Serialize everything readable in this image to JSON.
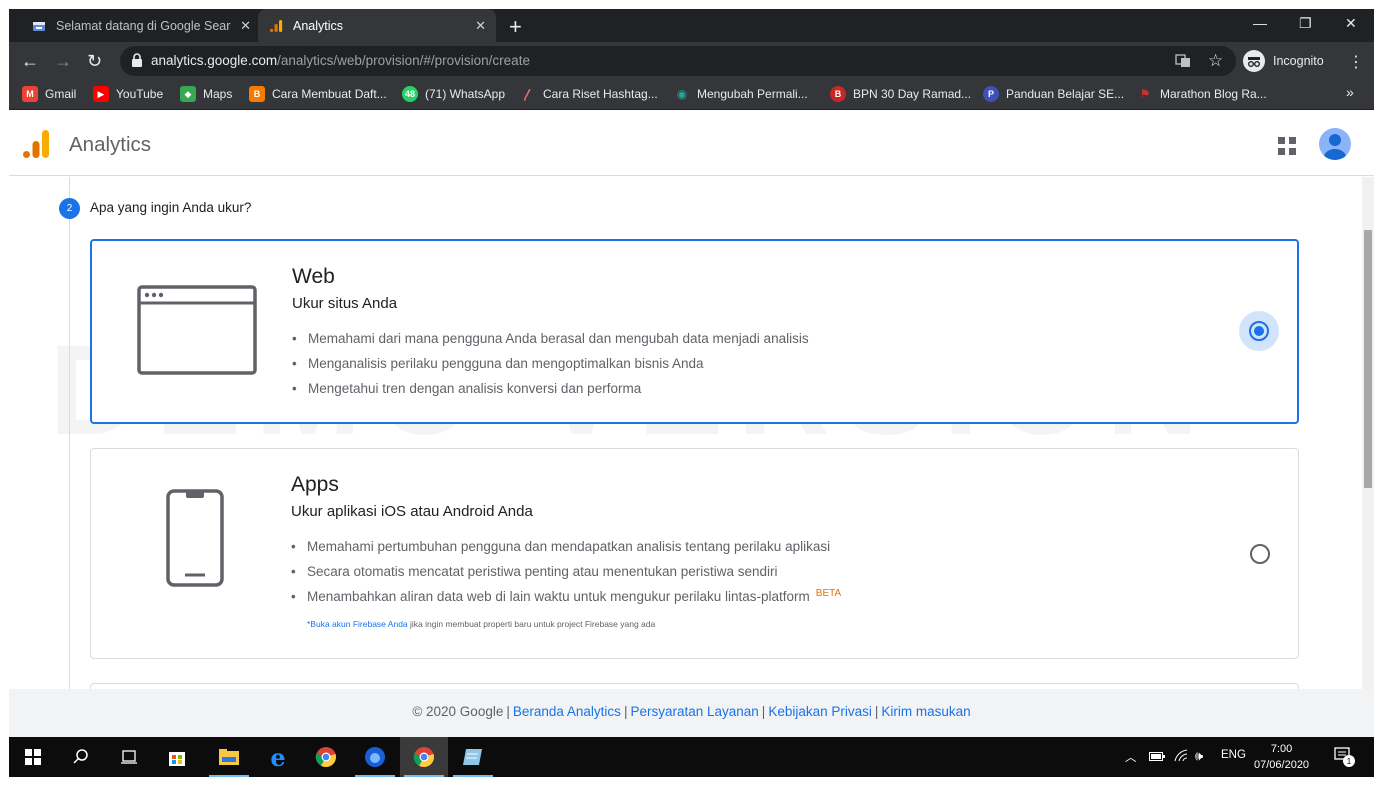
{
  "browser": {
    "tabs": [
      {
        "title": "Selamat datang di Google Search",
        "icon": "google-search-console-icon",
        "active": false
      },
      {
        "title": "Analytics",
        "icon": "analytics-icon",
        "active": true
      }
    ],
    "new_tab_label": "+",
    "url_host": "analytics.google.com",
    "url_path": "/analytics/web/provision/#/provision/create",
    "incognito_label": "Incognito",
    "bookmarks": [
      {
        "label": "Gmail",
        "icon": "gmail-icon",
        "color": "#ea4335"
      },
      {
        "label": "YouTube",
        "icon": "youtube-icon",
        "color": "#ff0000"
      },
      {
        "label": "Maps",
        "icon": "maps-icon",
        "color": "#34a853"
      },
      {
        "label": "Cara Membuat Daft...",
        "icon": "blogger-icon",
        "color": "#f57c00"
      },
      {
        "label": "(71) WhatsApp",
        "icon": "whatsapp-icon",
        "color": "#25d366"
      },
      {
        "label": "Cara Riset Hashtag...",
        "icon": "pin-icon",
        "color": "#e57373"
      },
      {
        "label": "Mengubah Permali...",
        "icon": "eye-icon",
        "color": "#26a69a"
      },
      {
        "label": "BPN 30 Day Ramad...",
        "icon": "bpn-icon",
        "color": "#c62828"
      },
      {
        "label": "Panduan Belajar SE...",
        "icon": "p-icon",
        "color": "#3f51b5"
      },
      {
        "label": "Marathon Blog Ra...",
        "icon": "flag-icon",
        "color": "#d32f2f"
      }
    ],
    "bookmarks_more": "»"
  },
  "header": {
    "title": "Analytics"
  },
  "step": {
    "number": "2",
    "question": "Apa yang ingin Anda ukur?"
  },
  "options": {
    "web": {
      "title": "Web",
      "subtitle": "Ukur situs Anda",
      "bullets": [
        "Memahami dari mana pengguna Anda berasal dan mengubah data menjadi analisis",
        "Menganalisis perilaku pengguna dan mengoptimalkan bisnis Anda",
        "Mengetahui tren dengan analisis konversi dan performa"
      ],
      "selected": true
    },
    "apps": {
      "title": "Apps",
      "subtitle": "Ukur aplikasi iOS atau Android Anda",
      "bullets": [
        "Memahami pertumbuhan pengguna dan mendapatkan analisis tentang perilaku aplikasi",
        "Secara otomatis mencatat peristiwa penting atau menentukan peristiwa sendiri",
        "Menambahkan aliran data web di lain waktu untuk mengukur perilaku lintas-platform"
      ],
      "beta": "BETA",
      "note_link": "*Buka akun Firebase Anda",
      "note_text": " jika ingin membuat properti baru untuk project Firebase yang ada",
      "selected": false
    }
  },
  "watermark": "DEMO VERSION",
  "footer": {
    "copyright": "© 2020 Google",
    "links": [
      "Beranda Analytics",
      "Persyaratan Layanan",
      "Kebijakan Privasi",
      "Kirim masukan"
    ]
  },
  "taskbar": {
    "language": "ENG",
    "time": "7:00",
    "date": "07/06/2020",
    "notification_count": "1"
  },
  "colors": {
    "accent": "#1a73e8",
    "beta": "#e37400"
  }
}
